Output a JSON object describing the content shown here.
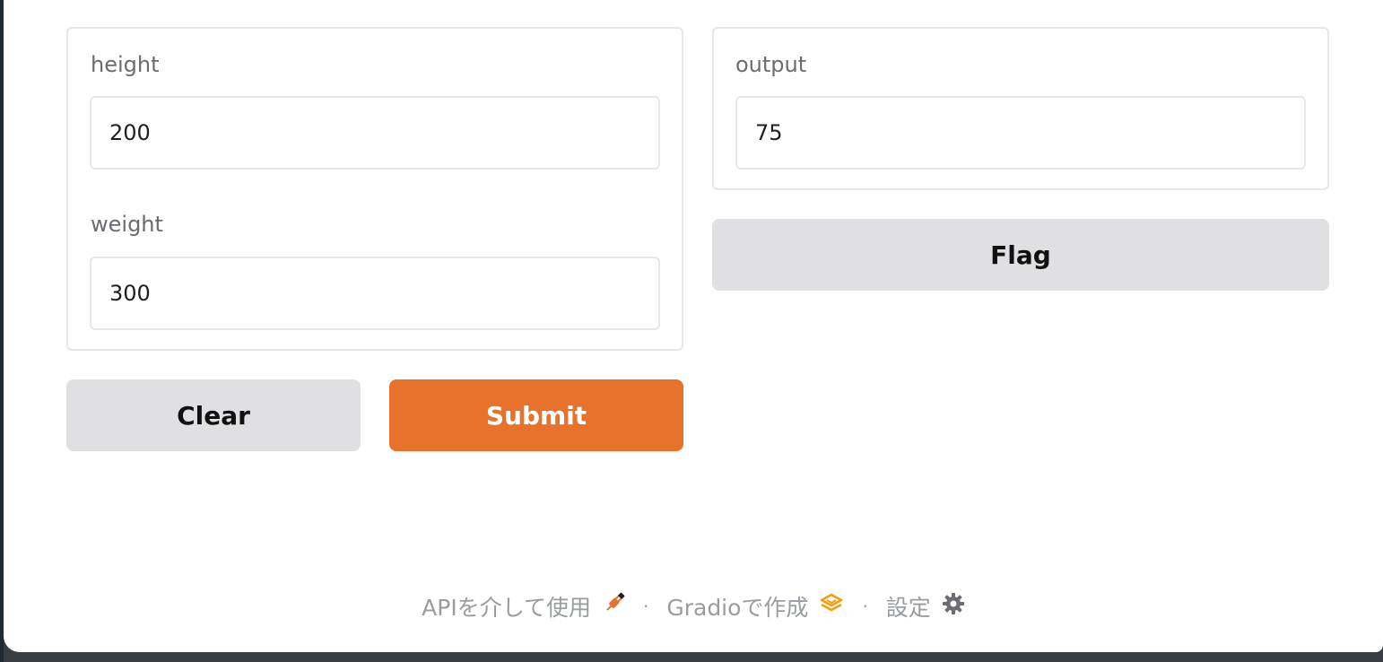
{
  "inputs": {
    "height_label": "height",
    "height_value": "200",
    "weight_label": "weight",
    "weight_value": "300"
  },
  "outputs": {
    "output_label": "output",
    "output_value": "75"
  },
  "buttons": {
    "clear": "Clear",
    "submit": "Submit",
    "flag": "Flag"
  },
  "footer": {
    "api_link": "APIを介して使用",
    "api_icon": "plug-icon",
    "gradio_link": "Gradioで作成",
    "gradio_icon": "gradio-logo-icon",
    "settings_link": "設定",
    "settings_icon": "gear-icon",
    "separator": "·"
  },
  "colors": {
    "primary": "#e6722b",
    "secondary_button": "#e0e0e2",
    "label": "#6b6b73",
    "footer_text": "#9a9ca3"
  }
}
